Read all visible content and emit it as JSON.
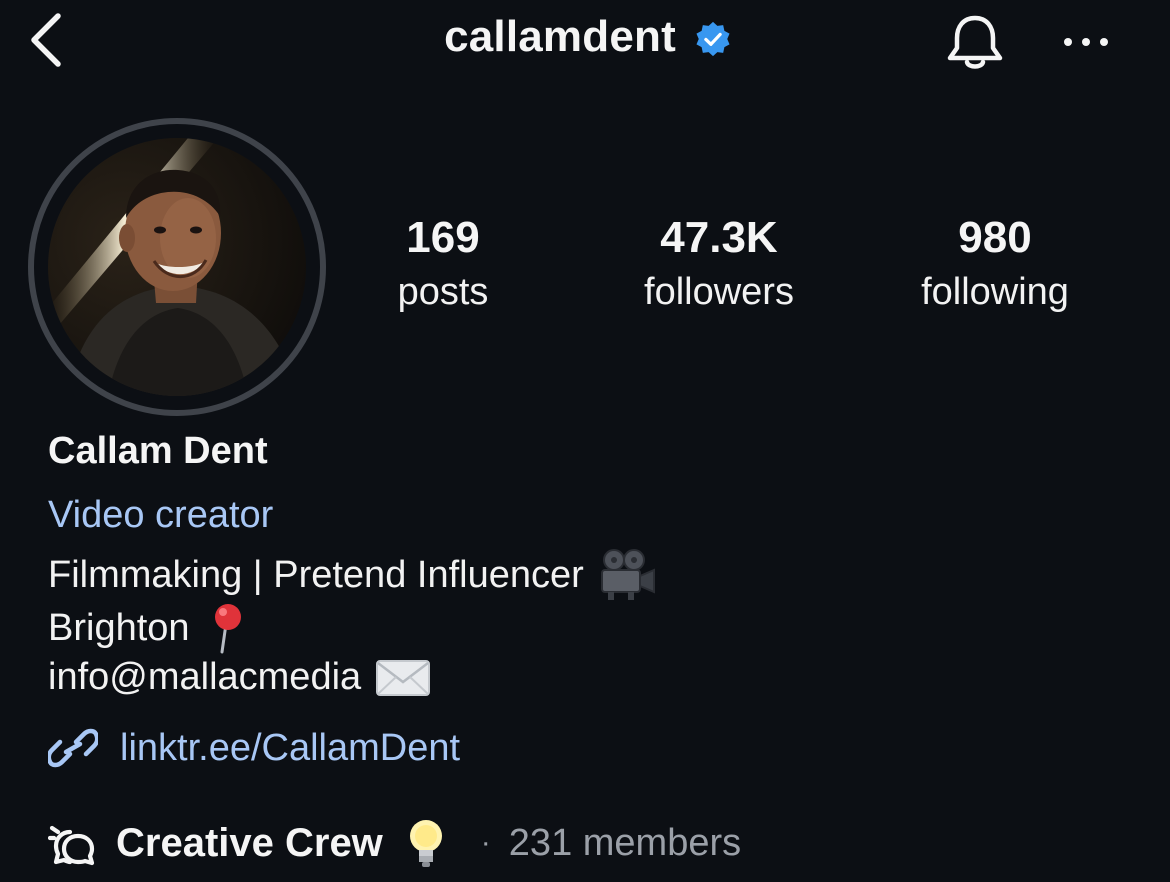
{
  "header": {
    "username": "callamdent",
    "icons": {
      "back": "chevron-left-icon",
      "verified": "verified-badge-icon",
      "notifications": "bell-icon",
      "more": "more-horizontal-icon"
    }
  },
  "profile": {
    "avatar_icon": "profile-photo",
    "stats": {
      "posts": {
        "value": "169",
        "label": "posts"
      },
      "followers": {
        "value": "47.3K",
        "label": "followers"
      },
      "following": {
        "value": "980",
        "label": "following"
      }
    },
    "display_name": "Callam Dent",
    "category": "Video creator",
    "bio_lines": [
      {
        "text": "Filmmaking | Pretend Influencer",
        "emoji_icon": "movie-camera-icon"
      },
      {
        "text": "Brighton",
        "emoji_icon": "round-pushpin-icon"
      },
      {
        "text": "info@mallacmedia",
        "emoji_icon": "envelope-icon"
      }
    ],
    "link": {
      "text": "linktr.ee/CallamDent",
      "icon": "link-icon"
    },
    "channel": {
      "icon": "broadcast-channel-icon",
      "name": "Creative Crew",
      "emoji_icon": "light-bulb-icon",
      "separator": "·",
      "members": "231 members"
    }
  },
  "colors": {
    "background": "#0c0f14",
    "text": "#f5f5f5",
    "link": "#a8c7f5",
    "muted": "#9ba0a8",
    "verified": "#3897f0",
    "avatar_ring": "#3f434a"
  }
}
